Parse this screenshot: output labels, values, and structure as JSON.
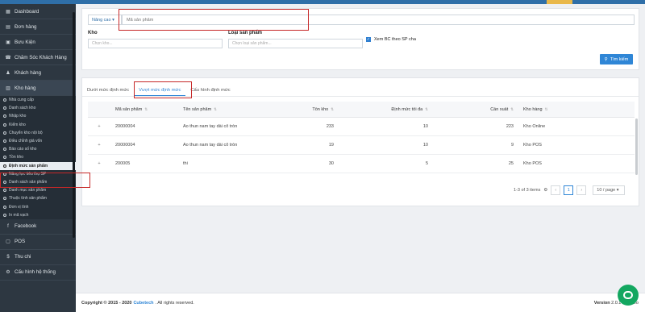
{
  "sidebar": {
    "items_top": [
      {
        "label": "Dashboard",
        "icon": "dashboard-icon",
        "glyph": "▦"
      },
      {
        "label": "Đơn hàng",
        "icon": "orders-icon",
        "glyph": "▤"
      },
      {
        "label": "Bưu Kiện",
        "icon": "package-icon",
        "glyph": "▣"
      },
      {
        "label": "Chăm Sóc Khách Hàng",
        "icon": "support-icon",
        "glyph": "☎"
      },
      {
        "label": "Khách hàng",
        "icon": "customers-icon",
        "glyph": "♟"
      },
      {
        "label": "Kho hàng",
        "icon": "warehouse-icon",
        "glyph": "▥"
      }
    ],
    "sub_items": [
      "Nhà cung cấp",
      "Danh sách kho",
      "Nhập kho",
      "Kiểm kho",
      "Chuyển kho nội bộ",
      "Điều chỉnh giá vốn",
      "Báo cáo số kho",
      "Tồn kho",
      "Định mức sản phẩm",
      "Năng lực tiêu thụ SP",
      "Danh sách sản phẩm",
      "Danh mục sản phẩm",
      "Thuộc tính sản phẩm",
      "Đơn vị tính",
      "In mã vạch"
    ],
    "active_sub": 8,
    "items_bottom": [
      {
        "label": "Facebook",
        "icon": "facebook-icon",
        "glyph": "f"
      },
      {
        "label": "POS",
        "icon": "pos-icon",
        "glyph": "▢"
      },
      {
        "label": "Thu chi",
        "icon": "money-icon",
        "glyph": "$"
      },
      {
        "label": "Cấu hình hệ thống",
        "icon": "settings-icon",
        "glyph": "⚙"
      }
    ]
  },
  "filters": {
    "advanced_label": "Nâng cao ▾",
    "search_placeholder": "Mã sản phẩm",
    "warehouse_label": "Kho",
    "warehouse_placeholder": "Chọn kho...",
    "product_type_label": "Loại sản phẩm",
    "product_type_placeholder": "Chọn loại sản phẩm...",
    "parent_checkbox_label": "Xem BC theo SP cha",
    "search_button": "Tìm kiếm"
  },
  "tabs": [
    "Dưới mức định mức",
    "Vượt mức định mức",
    "Cấu hình định mức"
  ],
  "active_tab": 1,
  "table": {
    "headers": [
      "Mã sản phẩm",
      "Tên sản phẩm",
      "Tồn kho",
      "Định mức tối đa",
      "Cần xuất",
      "Kho hàng"
    ],
    "rows": [
      {
        "expand": "+",
        "code": "20000004",
        "name": "Áo thun nam tay dài cổ tròn",
        "stock": "233",
        "max": "10",
        "export": "223",
        "warehouse": "Kho Online"
      },
      {
        "expand": "+",
        "code": "20000004",
        "name": "Áo thun nam tay dài cổ tròn",
        "stock": "19",
        "max": "10",
        "export": "9",
        "warehouse": "Kho POS"
      },
      {
        "expand": "+",
        "code": "200005",
        "name": "thi",
        "stock": "30",
        "max": "5",
        "export": "25",
        "warehouse": "Kho POS"
      }
    ]
  },
  "pagination": {
    "summary": "1-3 of 3 items",
    "prev": "‹",
    "current": "1",
    "next": "›",
    "page_size": "10 / page ▾"
  },
  "footer": {
    "copyright_prefix": "Copyright © 2015 - 2020",
    "brand": "Cubetech",
    "rights": ". All rights reserved.",
    "version_label": "Version",
    "version": "2.0.1",
    "version_tail": "eo"
  },
  "colors": {
    "sidebar_bg": "#2d3741",
    "accent": "#2f86d6",
    "highlight": "#c62828",
    "chat": "#13a760"
  }
}
